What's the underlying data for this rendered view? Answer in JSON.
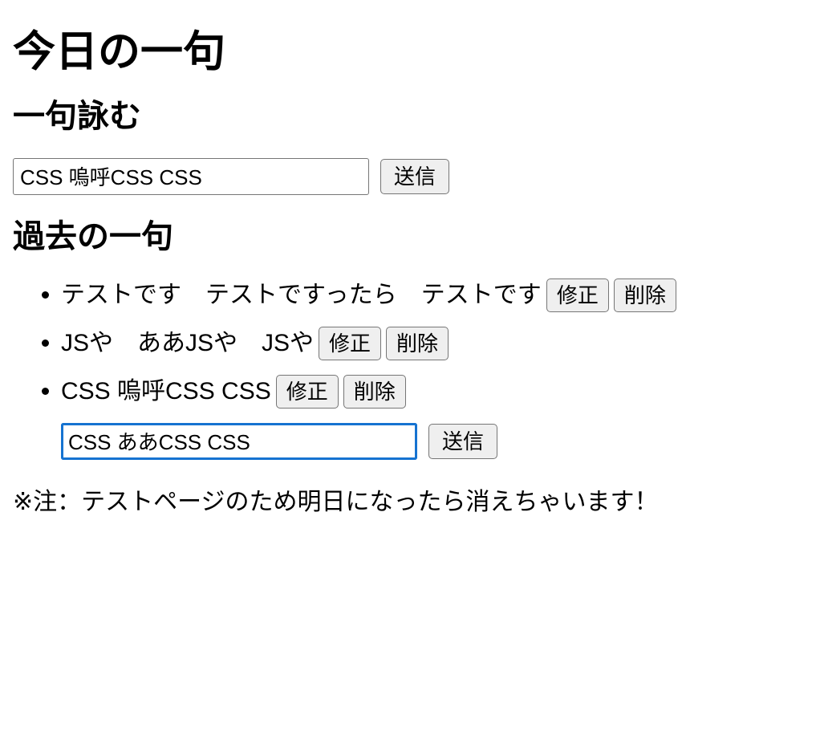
{
  "page": {
    "title": "今日の一句",
    "footnote": "※注：テストページのため明日になったら消えちゃいます！"
  },
  "compose": {
    "heading": "一句詠む",
    "input_value": "CSS 嗚呼CSS CSS",
    "input_placeholder": "",
    "submit_label": "送信"
  },
  "past": {
    "heading": "過去の一句",
    "edit_label": "修正",
    "delete_label": "削除",
    "items": [
      {
        "text": "テストです　テストですったら　テストです"
      },
      {
        "text": "JSや　ああJSや　JSや"
      },
      {
        "text": "CSS 嗚呼CSS CSS"
      }
    ],
    "edit_form": {
      "input_value": "CSS ああCSS CSS",
      "input_placeholder": "",
      "submit_label": "送信",
      "focused": true,
      "caret_after": "CSS ああ"
    }
  },
  "colors": {
    "text": "#000000",
    "background": "#ffffff",
    "button_face": "#efefef",
    "button_border": "#767676",
    "focus_ring": "#1673d1"
  }
}
